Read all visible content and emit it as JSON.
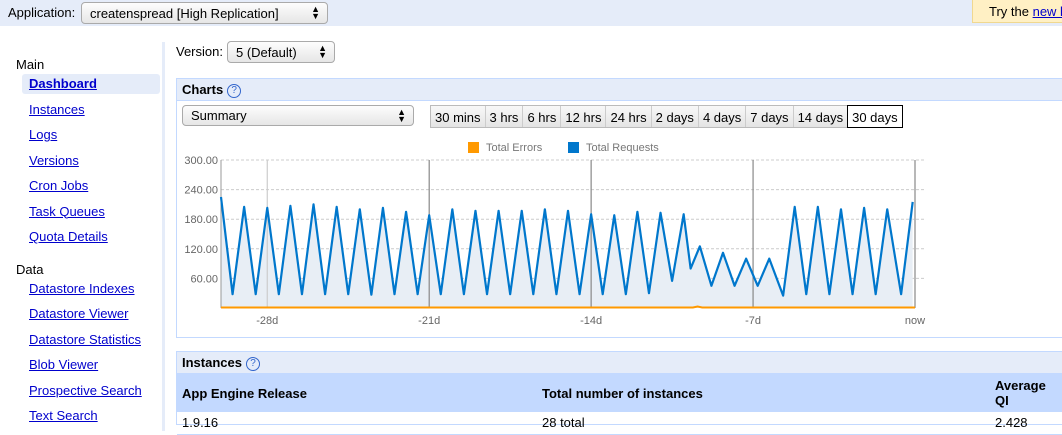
{
  "topbar": {
    "app_label": "Application:",
    "app_value": "createnspread [High Replication]",
    "try_prefix": "Try the ",
    "try_link": "new l"
  },
  "sidebar": {
    "sections": [
      {
        "title": "Main",
        "items": [
          "Dashboard",
          "Instances",
          "Logs",
          "Versions",
          "Cron Jobs",
          "Task Queues",
          "Quota Details"
        ]
      },
      {
        "title": "Data",
        "items": [
          "Datastore Indexes",
          "Datastore Viewer",
          "Datastore Statistics",
          "Blob Viewer",
          "Prospective Search",
          "Text Search"
        ]
      }
    ],
    "active": "Dashboard"
  },
  "version": {
    "label": "Version:",
    "value": "5 (Default)"
  },
  "charts": {
    "title": "Charts",
    "help": "?",
    "metric": "Summary",
    "ranges": [
      "30 mins",
      "3 hrs",
      "6 hrs",
      "12 hrs",
      "24 hrs",
      "2 days",
      "4 days",
      "7 days",
      "14 days",
      "30 days"
    ],
    "selected_range": "30 days"
  },
  "chart_data": {
    "type": "area",
    "legend": [
      "Total Errors",
      "Total Requests"
    ],
    "legend_placement": "top",
    "colors": {
      "Total Errors": "#ff9900",
      "Total Requests": "#0077cc",
      "fill": "#e8eef5"
    },
    "ylim": [
      0,
      300
    ],
    "yticks": [
      "60.00",
      "120.00",
      "180.00",
      "240.00",
      "300.00"
    ],
    "ytick_values": [
      60,
      120,
      180,
      240,
      300
    ],
    "xlim": [
      -30,
      0
    ],
    "xticks": [
      {
        "x": -28,
        "label": "-28d"
      },
      {
        "x": -21,
        "label": "-21d"
      },
      {
        "x": -14,
        "label": "-14d"
      },
      {
        "x": -7,
        "label": "-7d"
      },
      {
        "x": 0,
        "label": "now"
      }
    ],
    "grid": true,
    "series": [
      {
        "name": "Total Requests",
        "points": [
          [
            -30,
            225
          ],
          [
            -29.5,
            28
          ],
          [
            -29,
            205
          ],
          [
            -28.5,
            28
          ],
          [
            -28,
            203
          ],
          [
            -27.5,
            28
          ],
          [
            -27,
            207
          ],
          [
            -26.5,
            28
          ],
          [
            -26,
            210
          ],
          [
            -25.5,
            28
          ],
          [
            -25,
            205
          ],
          [
            -24.5,
            28
          ],
          [
            -24,
            200
          ],
          [
            -23.5,
            27
          ],
          [
            -23,
            203
          ],
          [
            -22.5,
            28
          ],
          [
            -22,
            195
          ],
          [
            -21.5,
            28
          ],
          [
            -21,
            188
          ],
          [
            -20.5,
            28
          ],
          [
            -20,
            200
          ],
          [
            -19.5,
            28
          ],
          [
            -19,
            197
          ],
          [
            -18.5,
            28
          ],
          [
            -18,
            197
          ],
          [
            -17.5,
            28
          ],
          [
            -17,
            197
          ],
          [
            -16.5,
            28
          ],
          [
            -16,
            200
          ],
          [
            -15.5,
            28
          ],
          [
            -15,
            197
          ],
          [
            -14.5,
            28
          ],
          [
            -14,
            190
          ],
          [
            -13.5,
            28
          ],
          [
            -13,
            188
          ],
          [
            -12.5,
            28
          ],
          [
            -12,
            195
          ],
          [
            -11.5,
            30
          ],
          [
            -11,
            193
          ],
          [
            -10.5,
            55
          ],
          [
            -10,
            190
          ],
          [
            -9.7,
            80
          ],
          [
            -9.3,
            125
          ],
          [
            -8.8,
            45
          ],
          [
            -8.3,
            112
          ],
          [
            -7.8,
            45
          ],
          [
            -7.3,
            100
          ],
          [
            -6.8,
            45
          ],
          [
            -6.3,
            100
          ],
          [
            -5.7,
            25
          ],
          [
            -5.2,
            205
          ],
          [
            -4.7,
            28
          ],
          [
            -4.2,
            205
          ],
          [
            -3.7,
            28
          ],
          [
            -3.2,
            200
          ],
          [
            -2.7,
            28
          ],
          [
            -2.2,
            203
          ],
          [
            -1.7,
            28
          ],
          [
            -1.2,
            200
          ],
          [
            -0.6,
            28
          ],
          [
            -0.1,
            215
          ]
        ]
      },
      {
        "name": "Total Errors",
        "points": [
          [
            -30,
            0
          ],
          [
            -9.6,
            0
          ],
          [
            -9.4,
            2
          ],
          [
            -9.2,
            0
          ],
          [
            0,
            0
          ]
        ]
      }
    ]
  },
  "instances": {
    "title": "Instances",
    "help": "?",
    "columns": [
      "App Engine Release",
      "Total number of instances",
      "Average QI"
    ],
    "rows": [
      [
        "1.9.16",
        "28 total",
        "2.428"
      ]
    ]
  }
}
